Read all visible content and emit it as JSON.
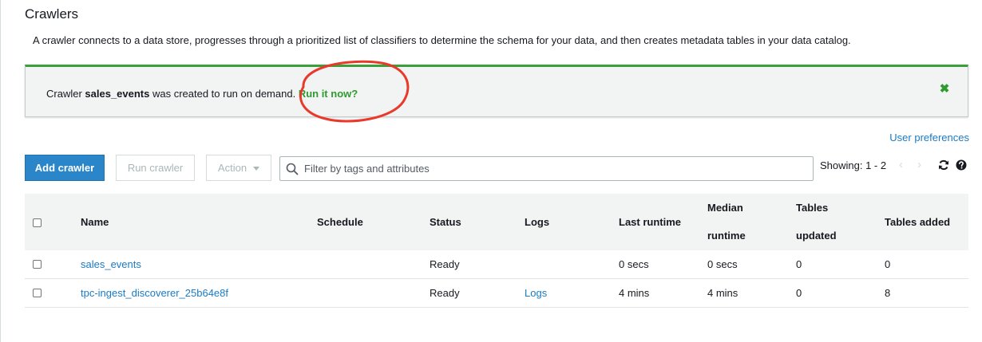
{
  "page": {
    "title": "Crawlers",
    "description": "A crawler connects to a data store, progresses through a prioritized list of classifiers to determine the schema for your data, and then creates metadata tables in your data catalog."
  },
  "flash": {
    "prefix": "Crawler ",
    "crawler_name": "sales_events",
    "suffix": " was created to run on demand. ",
    "link": "Run it now?",
    "close_icon": "close-icon",
    "color_success": "#3aa13a"
  },
  "annotation": {
    "color": "#e8392a"
  },
  "toolbar": {
    "user_preferences": "User preferences",
    "add_crawler": "Add crawler",
    "run_crawler": "Run crawler",
    "action": "Action",
    "filter_placeholder": "Filter by tags and attributes",
    "showing": "Showing: 1 - 2",
    "prev_icon": "chevron-left-icon",
    "next_icon": "chevron-right-icon",
    "refresh_icon": "refresh-icon",
    "help_icon": "help-icon"
  },
  "table": {
    "columns": {
      "name": "Name",
      "schedule": "Schedule",
      "status": "Status",
      "logs": "Logs",
      "last_runtime": "Last runtime",
      "median_runtime_1": "Median",
      "median_runtime_2": "runtime",
      "tables_updated_1": "Tables",
      "tables_updated_2": "updated",
      "tables_added": "Tables added"
    },
    "rows": [
      {
        "name": "sales_events",
        "schedule": "",
        "status": "Ready",
        "logs": "",
        "last_runtime": "0 secs",
        "median_runtime": "0 secs",
        "tables_updated": "0",
        "tables_added": "0"
      },
      {
        "name": "tpc-ingest_discoverer_25b64e8f",
        "schedule": "",
        "status": "Ready",
        "logs": "Logs",
        "last_runtime": "4 mins",
        "median_runtime": "4 mins",
        "tables_updated": "0",
        "tables_added": "8"
      }
    ]
  },
  "colors": {
    "primary": "#2a86c9",
    "link": "#1a7bc4",
    "header_bg": "#f2f3f3"
  }
}
